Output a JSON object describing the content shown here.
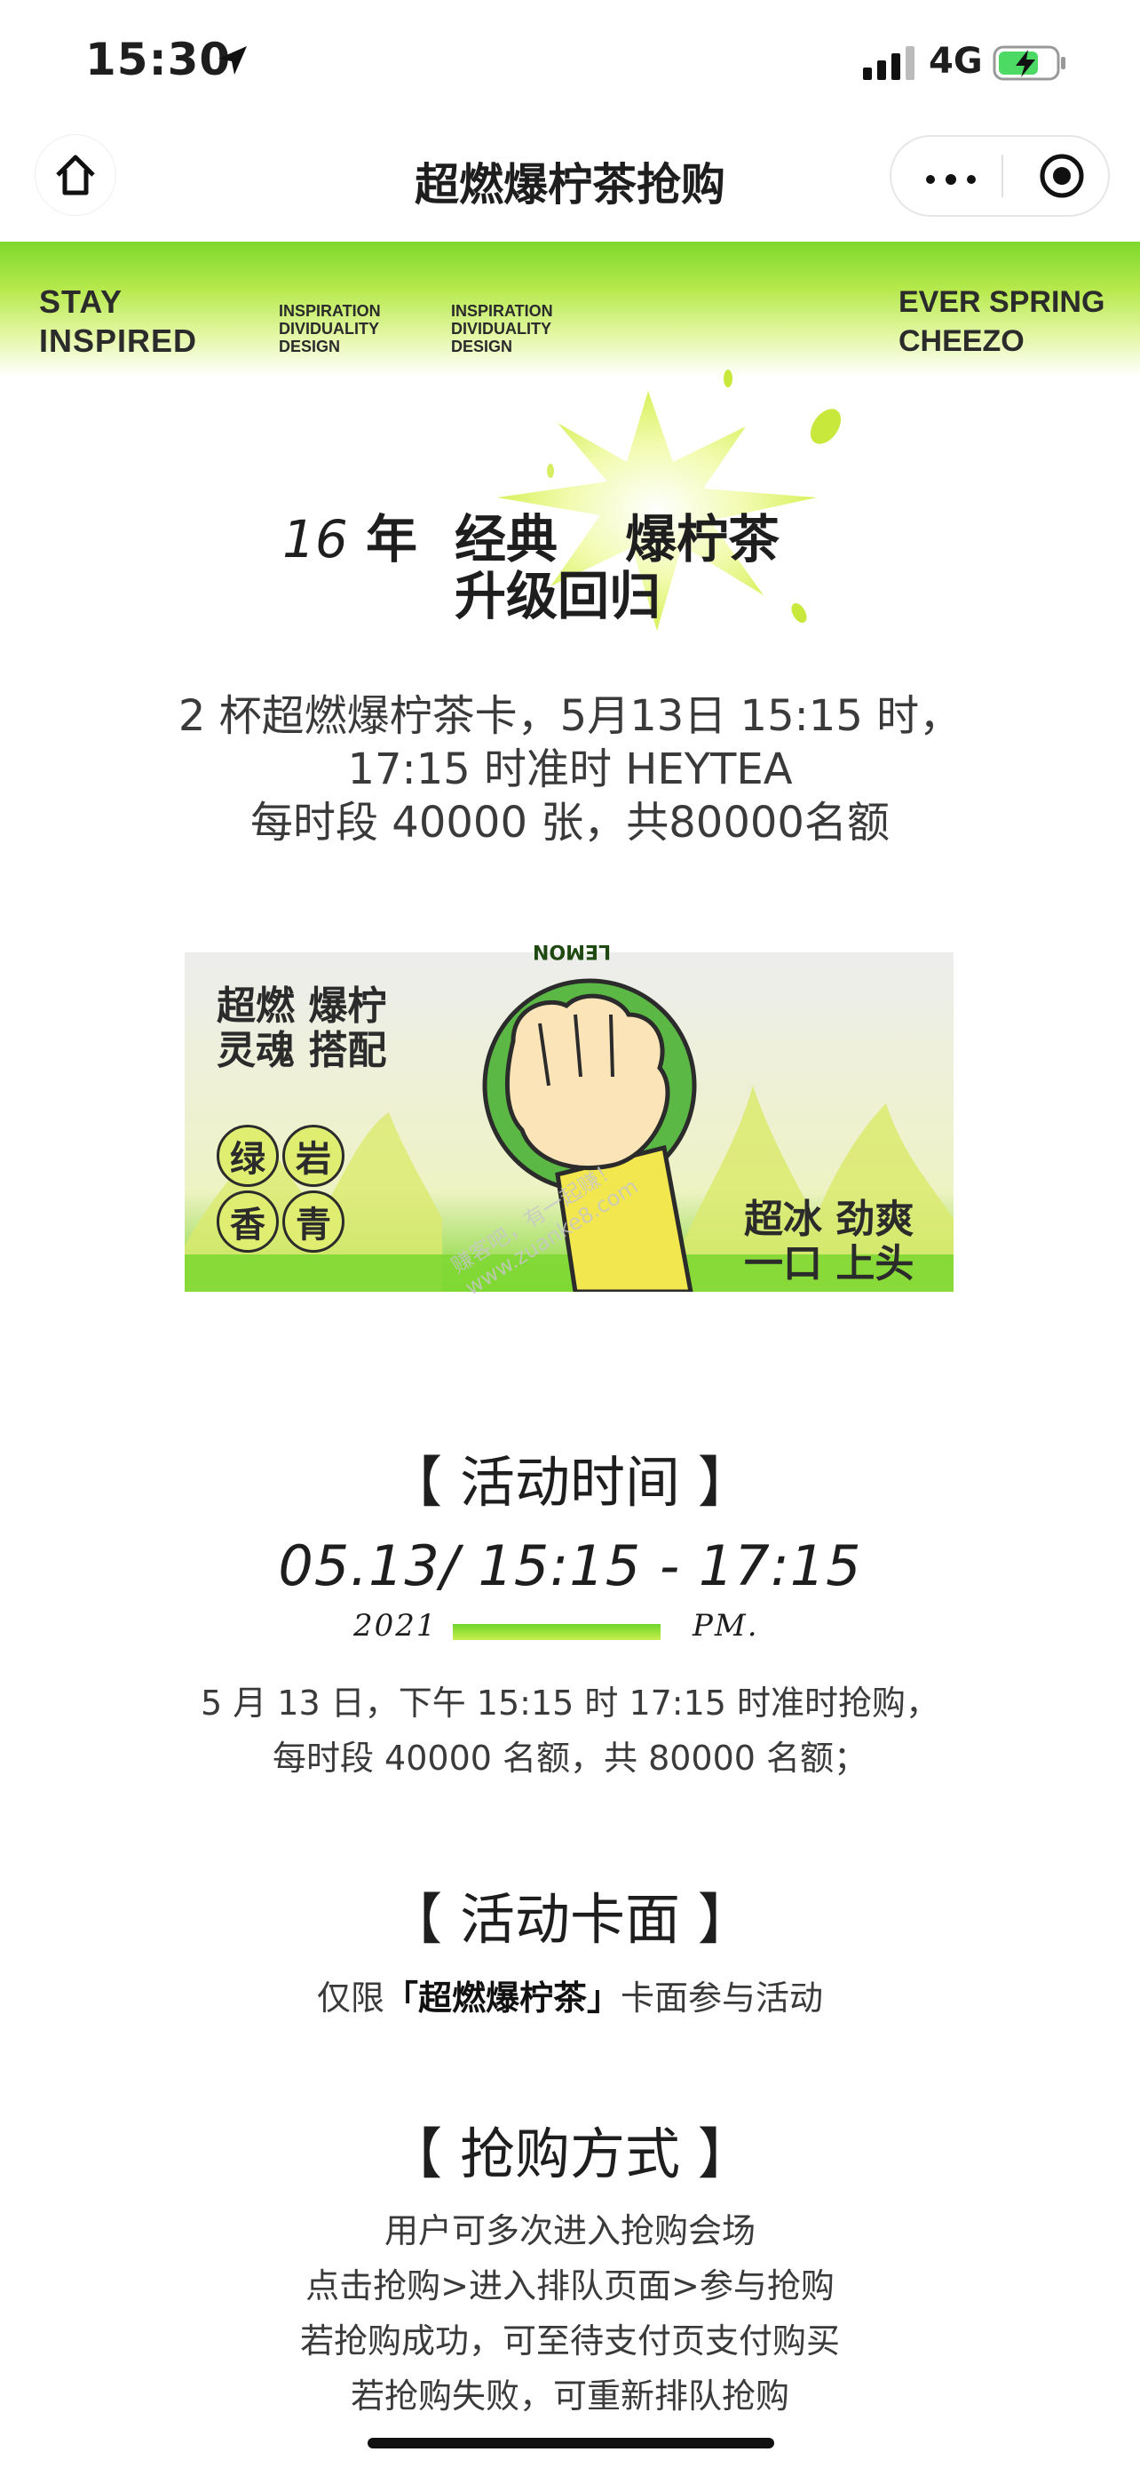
{
  "status_bar": {
    "time": "15:30",
    "network": "4G"
  },
  "nav": {
    "title": "超燃爆柠茶抢购"
  },
  "banner": {
    "left_line1": "STAY",
    "left_line2": "INSPIRED",
    "small_block": [
      "INSPIRATION",
      "DIVIDUALITY",
      "DESIGN"
    ],
    "right_line1": "EVER SPRING",
    "right_line2": "CHEEZO"
  },
  "headline": {
    "year_num": "16",
    "year_unit": "年",
    "classic": "经典",
    "lemon_tea": "爆柠茶",
    "return": "升级回归"
  },
  "intro": {
    "line1": "2 杯超燃爆柠茶卡，5月13日 15:15 时，",
    "line2": "17:15 时准时 HEYTEA",
    "line3": "每时段 40000 张，共80000名额"
  },
  "promo": {
    "top_left_1": "超燃 爆柠",
    "top_left_2": "灵魂 搭配",
    "circles": [
      "绿",
      "岩",
      "香",
      "青"
    ],
    "bottom_right_1": "超冰 劲爽",
    "bottom_right_2": "一口 上头",
    "lemon_label": "LEMON",
    "watermark_1": "赚客吧，有一起赚！",
    "watermark_2": "www.zuanke8.com"
  },
  "activity_time": {
    "title": "【 活动时间 】",
    "datetime": "05.13/ 15:15 - 17:15",
    "year": "2021",
    "period": "PM.",
    "desc1": "5 月 13 日，下午 15:15 时 17:15 时准时抢购，",
    "desc2": "每时段 40000 名额，共 80000 名额；"
  },
  "activity_card": {
    "title": "【 活动卡面 】",
    "prefix": "仅限",
    "card_name": "「超燃爆柠茶」",
    "suffix": "卡面参与活动"
  },
  "purchase_method": {
    "title": "【 抢购方式 】",
    "lines": [
      "用户可多次进入抢购会场",
      "点击抢购>进入排队页面>参与抢购",
      "若抢购成功，可至待支付页支付购买",
      "若抢购失败，可重新排队抢购"
    ]
  },
  "colors": {
    "accent_green": "#7dd82c",
    "lime": "#dfee70",
    "dark": "#1e1e1e"
  },
  "icons": [
    "location-arrow-icon",
    "signal-icon",
    "battery-charging-icon",
    "home-icon",
    "more-icon",
    "close-target-icon"
  ]
}
